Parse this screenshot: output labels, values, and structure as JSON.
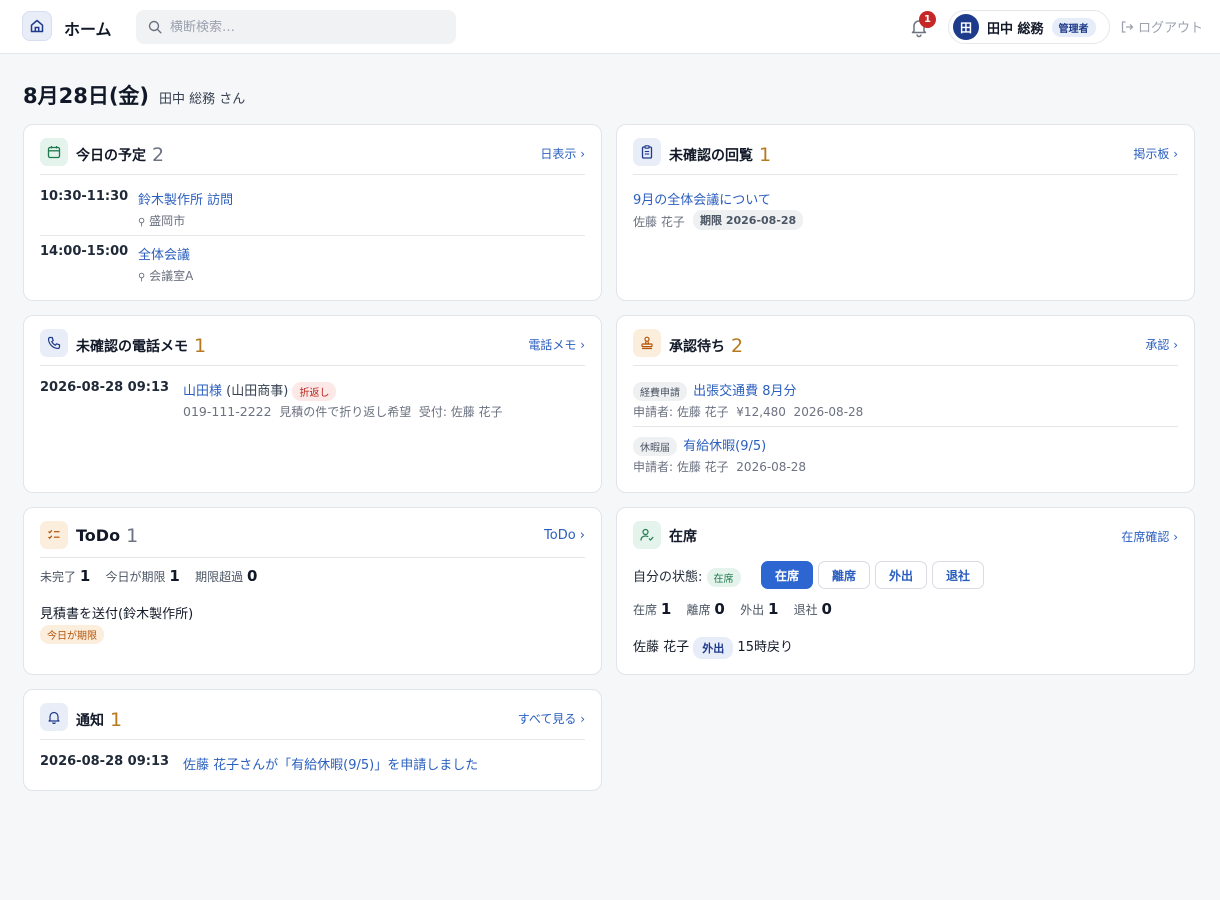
{
  "header": {
    "home_label": "ホーム",
    "search_placeholder": "横断検索…",
    "notification_count": "1",
    "user_initial": "田",
    "user_name": "田中 総務",
    "role": "管理者",
    "logout_label": "ログアウト"
  },
  "page": {
    "date": "8月28日(金)",
    "greeting": "田中 総務 さん"
  },
  "schedule": {
    "title": "今日の予定",
    "count": "2",
    "link": "日表示 ›",
    "items": [
      {
        "time": "10:30-11:30",
        "title": "鈴木製作所 訪問",
        "location": "盛岡市"
      },
      {
        "time": "14:00-15:00",
        "title": "全体会議",
        "location": "会議室A"
      }
    ]
  },
  "circulars": {
    "title": "未確認の回覧",
    "count": "1",
    "link": "掲示板 ›",
    "items": [
      {
        "title": "9月の全体会議について",
        "author": "佐藤 花子",
        "deadline": "期限 2026-08-28"
      }
    ]
  },
  "phone_memos": {
    "title": "未確認の電話メモ",
    "count": "1",
    "link": "電話メモ ›",
    "items": [
      {
        "datetime": "2026-08-28 09:13",
        "caller": "山田様",
        "company": "(山田商事)",
        "tag": "折返し",
        "phone": "019-111-2222",
        "note": "見積の件で折り返し希望",
        "received_by": "受付: 佐藤 花子"
      }
    ]
  },
  "approvals": {
    "title": "承認待ち",
    "count": "2",
    "link": "承認 ›",
    "items": [
      {
        "category": "経費申請",
        "title": "出張交通費 8月分",
        "meta": "申請者: 佐藤 花子  ¥12,480  2026-08-28"
      },
      {
        "category": "休暇届",
        "title": "有給休暇(9/5)",
        "meta": "申請者: 佐藤 花子  2026-08-28"
      }
    ]
  },
  "todo": {
    "title": "ToDo",
    "count": "1",
    "link": "ToDo ›",
    "stats": [
      {
        "label": "未完了",
        "value": "1"
      },
      {
        "label": "今日が期限",
        "value": "1"
      },
      {
        "label": "期限超過",
        "value": "0"
      }
    ],
    "items": [
      {
        "title": "見積書を送付(鈴木製作所)",
        "tag": "今日が期限"
      }
    ]
  },
  "presence": {
    "title": "在席",
    "link": "在席確認 ›",
    "my_status_label": "自分の状態:",
    "my_status": "在席",
    "buttons": [
      "在席",
      "離席",
      "外出",
      "退社"
    ],
    "active_button": "在席",
    "stats": [
      {
        "label": "在席",
        "value": "1"
      },
      {
        "label": "離席",
        "value": "0"
      },
      {
        "label": "外出",
        "value": "1"
      },
      {
        "label": "退社",
        "value": "0"
      }
    ],
    "members": [
      {
        "name": "佐藤 花子",
        "status": "外出",
        "note": "15時戻り"
      }
    ]
  },
  "notifications": {
    "title": "通知",
    "count": "1",
    "link": "すべて見る ›",
    "items": [
      {
        "datetime": "2026-08-28 09:13",
        "message": "佐藤 花子さんが「有給休暇(9/5)」を申請しました"
      }
    ]
  },
  "colors": {
    "accent": "#2d66d1",
    "link": "#2b5fbf",
    "count_amber": "#b7791f",
    "danger": "#c62828"
  }
}
